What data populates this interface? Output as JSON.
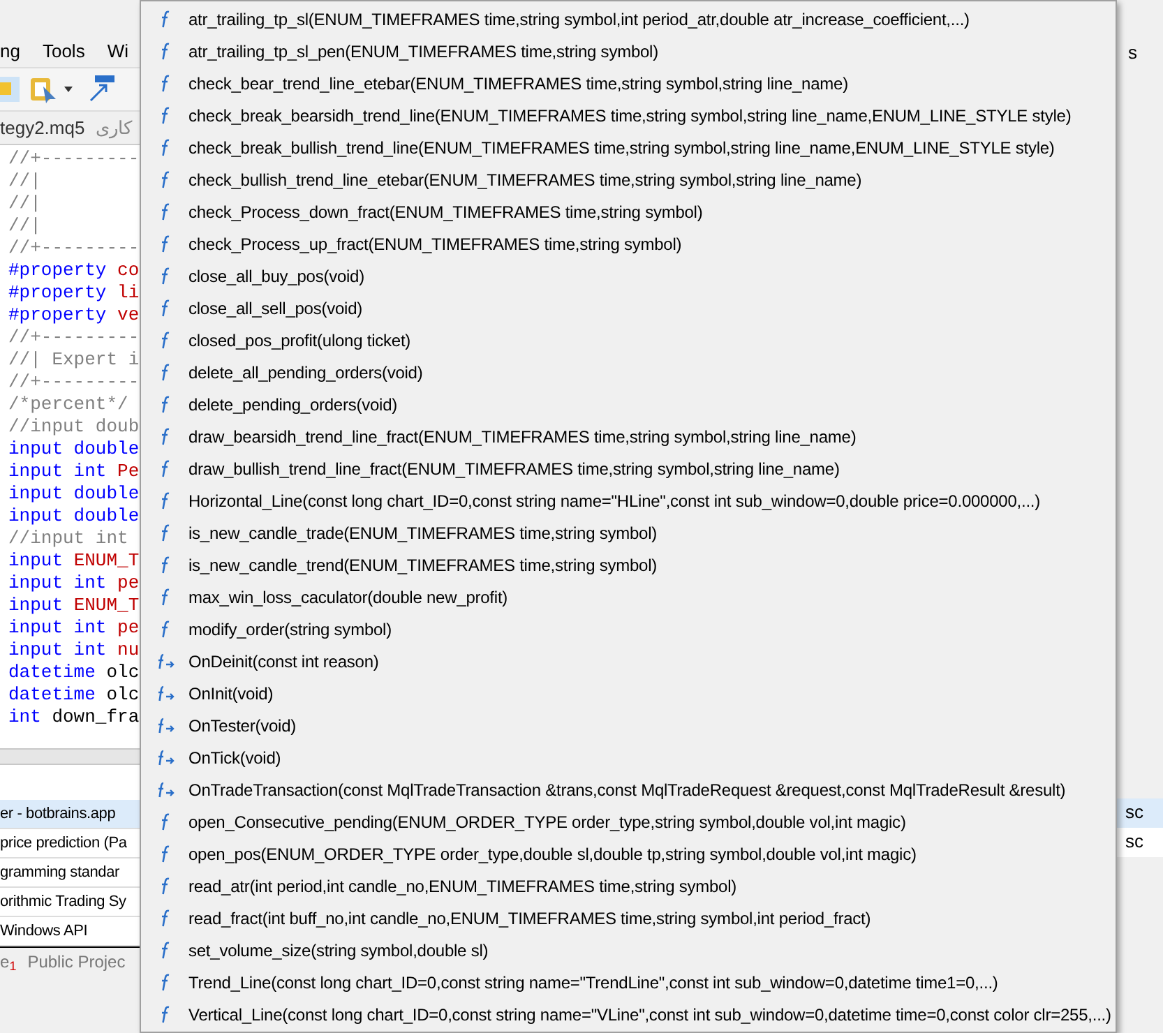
{
  "menu": [
    {
      "label": "ng"
    },
    {
      "label": "Tools"
    },
    {
      "label": "Wi"
    }
  ],
  "editor_tabs": [
    {
      "label": "tegy2.mq5",
      "selected": true
    },
    {
      "label": "کاری",
      "selected": false
    }
  ],
  "code_lines": [
    [
      {
        "text": "//+---------",
        "kind": "comment"
      }
    ],
    [
      {
        "text": "//|",
        "kind": "comment"
      }
    ],
    [
      {
        "text": "//|",
        "kind": "comment"
      }
    ],
    [
      {
        "text": "//|",
        "kind": "comment"
      }
    ],
    [
      {
        "text": "//+---------",
        "kind": "comment"
      }
    ],
    [
      {
        "text": "#property",
        "kind": "keyword"
      },
      {
        "text": "co",
        "kind": "value"
      }
    ],
    [
      {
        "text": "#property",
        "kind": "keyword"
      },
      {
        "text": "li",
        "kind": "value"
      }
    ],
    [
      {
        "text": "#property",
        "kind": "keyword"
      },
      {
        "text": "ve",
        "kind": "value"
      }
    ],
    [
      {
        "text": "//+---------",
        "kind": "comment"
      }
    ],
    [
      {
        "text": "//| Expert i",
        "kind": "comment"
      }
    ],
    [
      {
        "text": "//+---------",
        "kind": "comment"
      }
    ],
    [
      {
        "text": "/*percent*/",
        "kind": "comment"
      }
    ],
    [
      {
        "text": "//input doub",
        "kind": "comment"
      }
    ],
    [
      {
        "text": "input double",
        "kind": "keyword"
      }
    ],
    [
      {
        "text": "input int",
        "kind": "keyword"
      },
      {
        "text": "Pe",
        "kind": "value"
      }
    ],
    [
      {
        "text": "input double",
        "kind": "keyword"
      }
    ],
    [
      {
        "text": "input double",
        "kind": "keyword"
      }
    ],
    [
      {
        "text": "//input int",
        "kind": "comment"
      }
    ],
    [
      {
        "text": "input",
        "kind": "keyword"
      },
      {
        "text": "ENUM_T",
        "kind": "value"
      }
    ],
    [
      {
        "text": "input int",
        "kind": "keyword"
      },
      {
        "text": "pe",
        "kind": "value"
      }
    ],
    [
      {
        "text": "input",
        "kind": "keyword"
      },
      {
        "text": "ENUM_T",
        "kind": "value"
      }
    ],
    [
      {
        "text": "input int",
        "kind": "keyword"
      },
      {
        "text": "pe",
        "kind": "value"
      }
    ],
    [
      {
        "text": "input int",
        "kind": "keyword"
      },
      {
        "text": "nu",
        "kind": "value"
      }
    ],
    [
      {
        "text": "datetime",
        "kind": "keyword"
      },
      {
        "text": "olc",
        "kind": "plain"
      }
    ],
    [
      {
        "text": "datetime",
        "kind": "keyword"
      },
      {
        "text": "olc",
        "kind": "plain"
      }
    ],
    [
      {
        "text": "int",
        "kind": "keyword"
      },
      {
        "text": "down_fra",
        "kind": "plain"
      }
    ]
  ],
  "bottom_panel": {
    "rows": [
      {
        "text": "er - botbrains.app",
        "selected": true
      },
      {
        "text": "price prediction (Pa",
        "selected": false
      },
      {
        "text": "gramming standar",
        "selected": false
      },
      {
        "text": "orithmic Trading Sy",
        "selected": false
      },
      {
        "text": "Windows API",
        "selected": false
      }
    ],
    "tabs": [
      {
        "label": "e",
        "badge": "1"
      },
      {
        "label": "Public Projec"
      }
    ]
  },
  "right_strip": {
    "top": "s",
    "rows": [
      {
        "text": "sc",
        "selected": true
      },
      {
        "text": "sc",
        "selected": false
      }
    ]
  },
  "autocomplete": [
    {
      "kind": "function",
      "text": "atr_trailing_tp_sl(ENUM_TIMEFRAMES time,string symbol,int period_atr,double atr_increase_coefficient,...)"
    },
    {
      "kind": "function",
      "text": "atr_trailing_tp_sl_pen(ENUM_TIMEFRAMES time,string symbol)"
    },
    {
      "kind": "function",
      "text": "check_bear_trend_line_etebar(ENUM_TIMEFRAMES time,string symbol,string line_name)"
    },
    {
      "kind": "function",
      "text": "check_break_bearsidh_trend_line(ENUM_TIMEFRAMES time,string symbol,string line_name,ENUM_LINE_STYLE style)"
    },
    {
      "kind": "function",
      "text": "check_break_bullish_trend_line(ENUM_TIMEFRAMES time,string symbol,string line_name,ENUM_LINE_STYLE style)"
    },
    {
      "kind": "function",
      "text": "check_bullish_trend_line_etebar(ENUM_TIMEFRAMES time,string symbol,string line_name)"
    },
    {
      "kind": "function",
      "text": "check_Process_down_fract(ENUM_TIMEFRAMES time,string symbol)"
    },
    {
      "kind": "function",
      "text": "check_Process_up_fract(ENUM_TIMEFRAMES time,string symbol)"
    },
    {
      "kind": "function",
      "text": "close_all_buy_pos(void)"
    },
    {
      "kind": "function",
      "text": "close_all_sell_pos(void)"
    },
    {
      "kind": "function",
      "text": "closed_pos_profit(ulong ticket)"
    },
    {
      "kind": "function",
      "text": "delete_all_pending_orders(void)"
    },
    {
      "kind": "function",
      "text": "delete_pending_orders(void)"
    },
    {
      "kind": "function",
      "text": "draw_bearsidh_trend_line_fract(ENUM_TIMEFRAMES time,string symbol,string line_name)"
    },
    {
      "kind": "function",
      "text": "draw_bullish_trend_line_fract(ENUM_TIMEFRAMES time,string symbol,string line_name)"
    },
    {
      "kind": "function",
      "text": "Horizontal_Line(const long chart_ID=0,const string name=\"HLine\",const int sub_window=0,double price=0.000000,...)"
    },
    {
      "kind": "function",
      "text": "is_new_candle_trade(ENUM_TIMEFRAMES time,string symbol)"
    },
    {
      "kind": "function",
      "text": "is_new_candle_trend(ENUM_TIMEFRAMES time,string symbol)"
    },
    {
      "kind": "function",
      "text": "max_win_loss_caculator(double new_profit)"
    },
    {
      "kind": "function",
      "text": "modify_order(string symbol)"
    },
    {
      "kind": "event",
      "text": "OnDeinit(const int reason)"
    },
    {
      "kind": "event",
      "text": "OnInit(void)"
    },
    {
      "kind": "event",
      "text": "OnTester(void)"
    },
    {
      "kind": "event",
      "text": "OnTick(void)"
    },
    {
      "kind": "event",
      "text": "OnTradeTransaction(const MqlTradeTransaction &trans,const MqlTradeRequest &request,const MqlTradeResult &result)"
    },
    {
      "kind": "function",
      "text": "open_Consecutive_pending(ENUM_ORDER_TYPE order_type,string symbol,double vol,int magic)"
    },
    {
      "kind": "function",
      "text": "open_pos(ENUM_ORDER_TYPE order_type,double sl,double tp,string symbol,double vol,int magic)"
    },
    {
      "kind": "function",
      "text": "read_atr(int period,int candle_no,ENUM_TIMEFRAMES time,string symbol)"
    },
    {
      "kind": "function",
      "text": "read_fract(int buff_no,int candle_no,ENUM_TIMEFRAMES time,string symbol,int period_fract)"
    },
    {
      "kind": "function",
      "text": "set_volume_size(string symbol,double sl)"
    },
    {
      "kind": "function",
      "text": "Trend_Line(const long chart_ID=0,const string name=\"TrendLine\",const int sub_window=0,datetime time1=0,...)"
    },
    {
      "kind": "function",
      "text": "Vertical_Line(const long chart_ID=0,const string name=\"VLine\",const int sub_window=0,datetime time=0,const color clr=255,...)"
    }
  ]
}
